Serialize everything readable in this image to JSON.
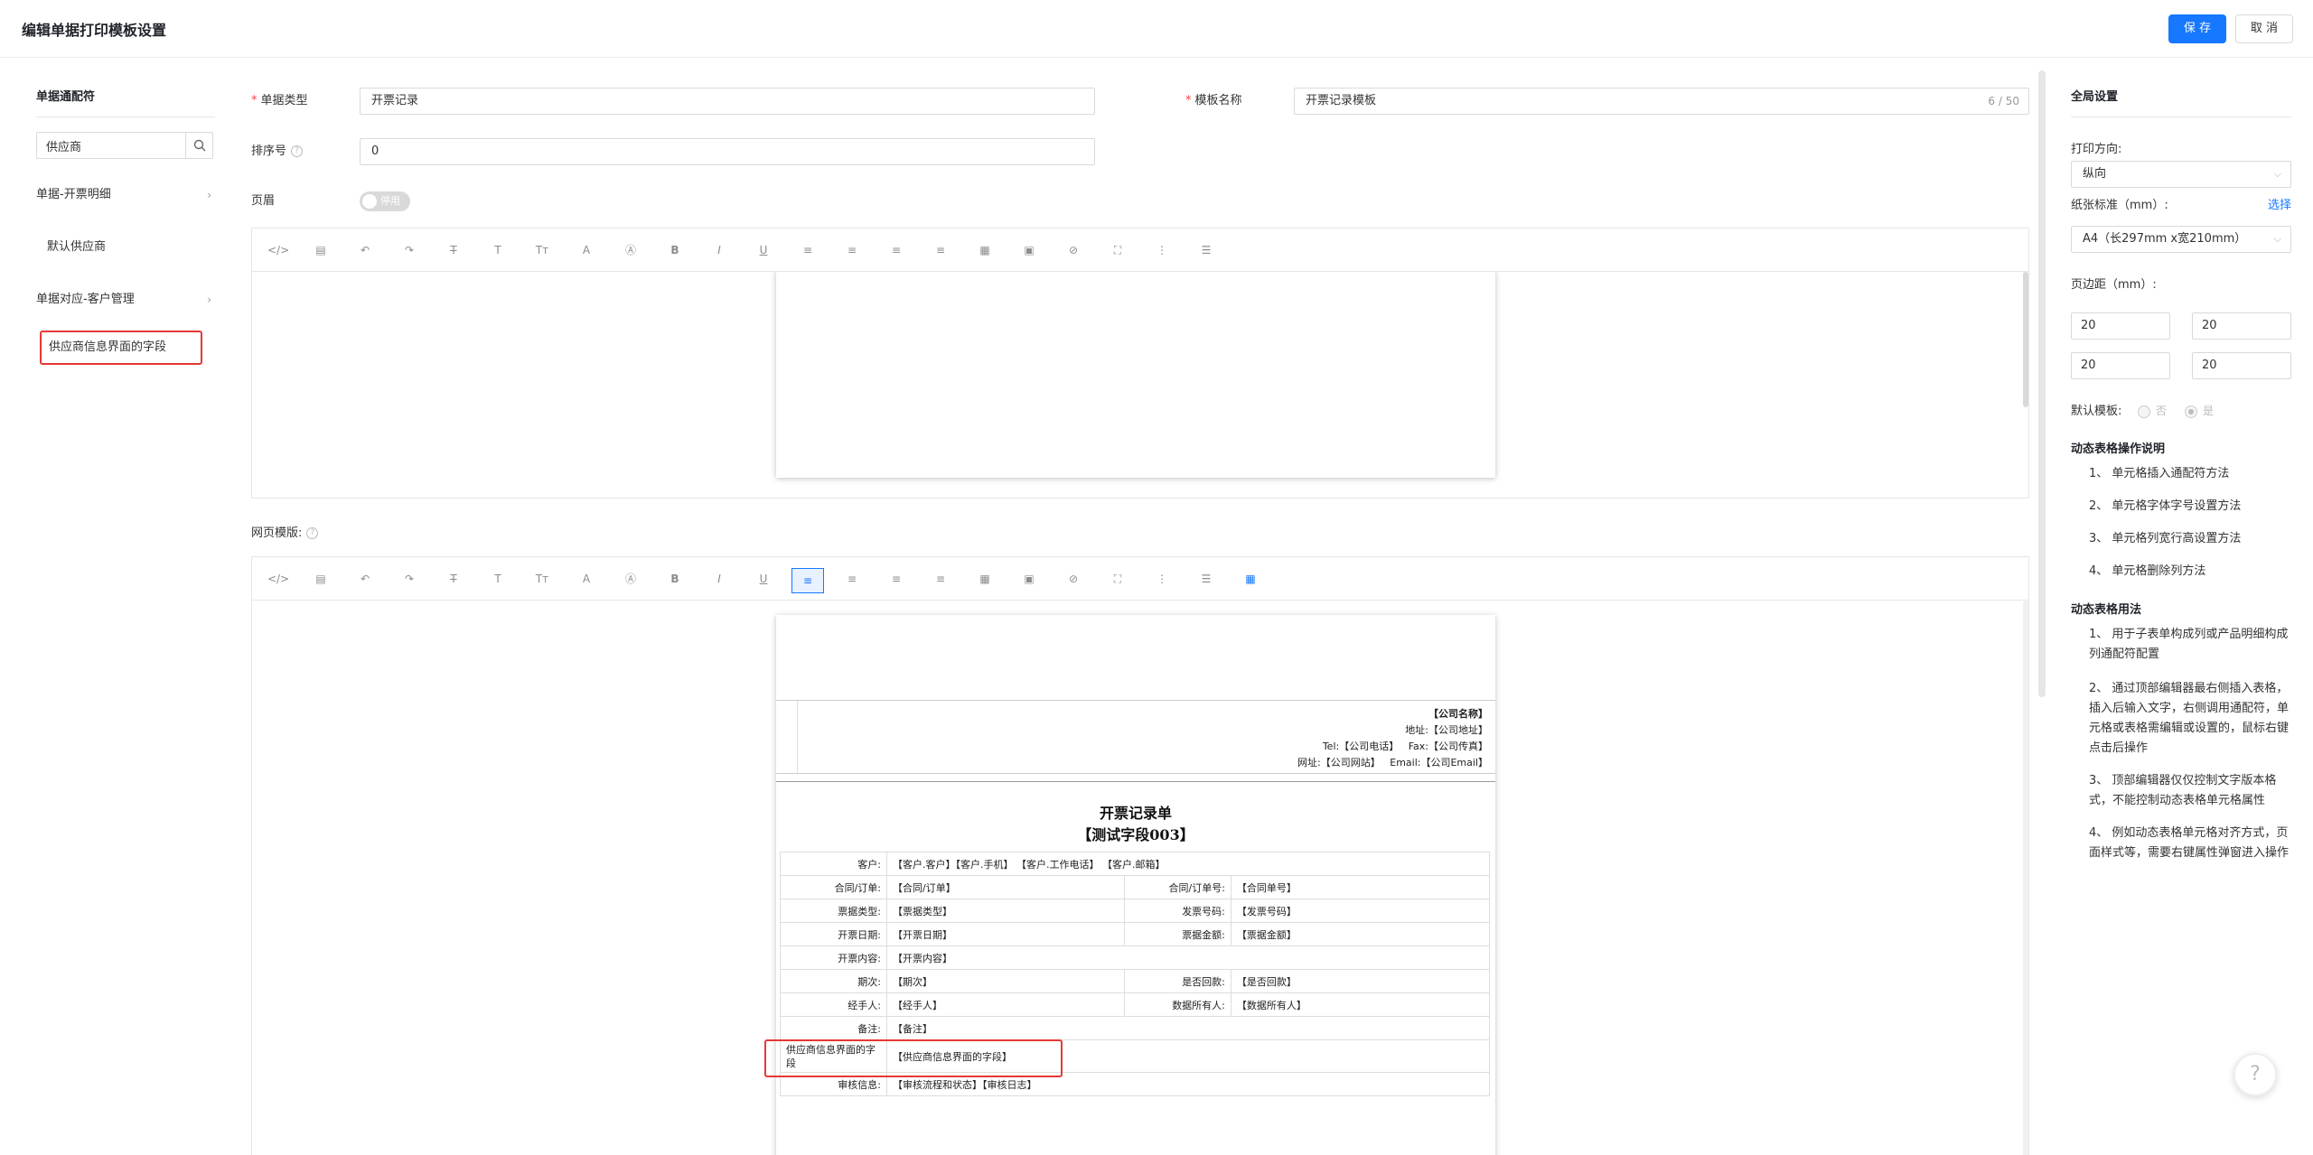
{
  "header": {
    "title": "编辑单据打印模板设置",
    "save_label": "保 存",
    "cancel_label": "取 消"
  },
  "left": {
    "title": "单据通配符",
    "search_value": "供应商",
    "groups": [
      {
        "label": "单据-开票明细",
        "children": [
          "默认供应商"
        ]
      },
      {
        "label": "单据对应-客户管理",
        "children": [
          "供应商信息界面的字段"
        ]
      }
    ]
  },
  "form": {
    "doc_type_label": "单据类型",
    "doc_type_value": "开票记录",
    "template_name_label": "模板名称",
    "template_name_value": "开票记录模板",
    "template_name_count": "6 / 50",
    "sort_label": "排序号",
    "sort_value": "0",
    "header_label": "页眉",
    "header_switch": "停用",
    "web_template_label": "网页模版:"
  },
  "toolbar_icons": [
    "code-icon",
    "template-icon",
    "undo-icon",
    "redo-icon",
    "strikethrough-icon",
    "font-size-icon",
    "font-family-icon",
    "font-color-icon",
    "background-color-icon",
    "bold-icon",
    "italic-icon",
    "underline-icon",
    "align-left-icon",
    "align-center-icon",
    "align-right-icon",
    "justify-icon",
    "table-icon",
    "image-icon",
    "attachment-icon",
    "fullscreen-icon",
    "ordered-list-icon",
    "bullet-list-icon"
  ],
  "template": {
    "company_name": "【公司名称】",
    "address": "地址:【公司地址】",
    "tel": "Tel:【公司电话】",
    "fax": "Fax:【公司传真】",
    "website": "网址:【公司网站】",
    "email": "Email:【公司Email】",
    "title1": "开票记录单",
    "title2": "【测试字段003】",
    "rows": [
      {
        "l1": "客户:",
        "v1": "【客户.客户】【客户.手机】 【客户.工作电话】 【客户.邮箱】",
        "l2": "",
        "v2": ""
      },
      {
        "l1": "合同/订单:",
        "v1": "【合同/订单】",
        "l2": "合同/订单号:",
        "v2": "【合同单号】"
      },
      {
        "l1": "票据类型:",
        "v1": "【票据类型】",
        "l2": "发票号码:",
        "v2": "【发票号码】"
      },
      {
        "l1": "开票日期:",
        "v1": "【开票日期】",
        "l2": "票据金额:",
        "v2": "【票据金额】"
      },
      {
        "l1": "开票内容:",
        "v1": "【开票内容】",
        "l2": "",
        "v2": ""
      },
      {
        "l1": "期次:",
        "v1": "【期次】",
        "l2": "是否回款:",
        "v2": "【是否回款】"
      },
      {
        "l1": "经手人:",
        "v1": "【经手人】",
        "l2": "数据所有人:",
        "v2": "【数据所有人】"
      },
      {
        "l1": "备注:",
        "v1": "【备注】",
        "l2": "",
        "v2": ""
      },
      {
        "l1": "供应商信息界面的字段",
        "v1": "【供应商信息界面的字段】",
        "l2": "",
        "v2": ""
      },
      {
        "l1": "审核信息:",
        "v1": "【审核流程和状态】【审核日志】",
        "l2": "",
        "v2": ""
      }
    ]
  },
  "right": {
    "title": "全局设置",
    "orientation_label": "打印方向:",
    "orientation_value": "纵向",
    "paper_label": "纸张标准（mm）:",
    "paper_link": "选择",
    "paper_value": "A4（长297mm x宽210mm）",
    "margin_label": "页边距（mm）:",
    "margins": [
      "20",
      "20",
      "20",
      "20"
    ],
    "default_label": "默认模板:",
    "default_no": "否",
    "default_yes": "是",
    "ops_title": "动态表格操作说明",
    "ops": [
      "1、 单元格插入通配符方法",
      "2、 单元格字体字号设置方法",
      "3、 单元格列宽行高设置方法",
      "4、 单元格删除列方法"
    ],
    "usage_title": "动态表格用法",
    "usage": [
      "1、 用于子表单构成列或产品明细构成列通配符配置",
      "2、 通过顶部编辑器最右侧插入表格，插入后输入文字，右侧调用通配符，单元格或表格需编辑或设置的，鼠标右键点击后操作",
      "3、 顶部编辑器仅仅控制文字版本格式，不能控制动态表格单元格属性",
      "4、 例如动态表格单元格对齐方式，页面样式等，需要右键属性弹窗进入操作"
    ]
  }
}
